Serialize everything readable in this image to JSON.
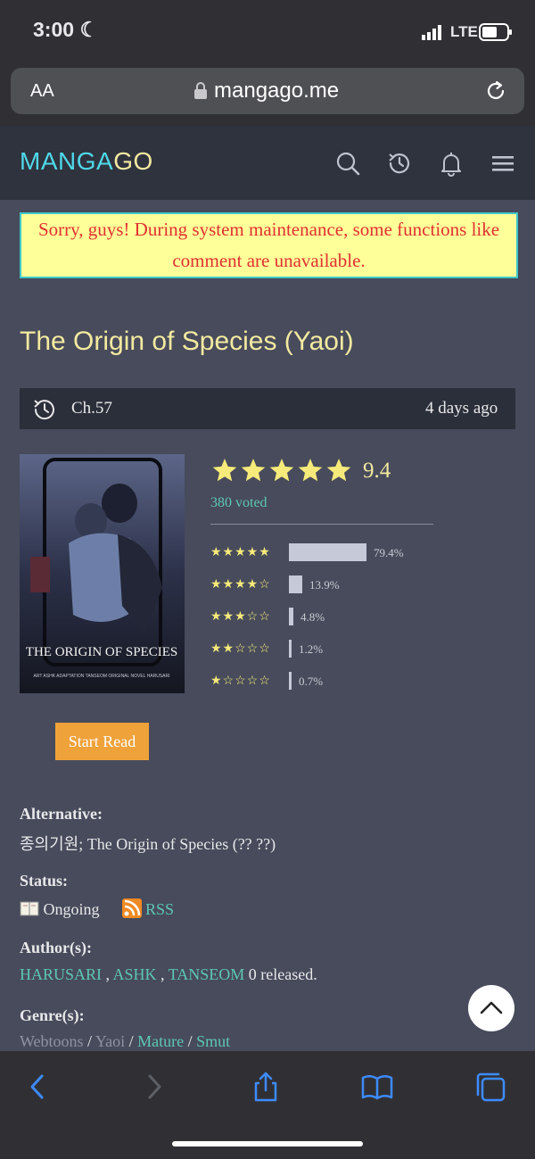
{
  "status_bar": {
    "time": "3:00",
    "network": "LTE"
  },
  "browser": {
    "text_size_label": "AA",
    "url": "mangago.me"
  },
  "site": {
    "logo_part1": "MANGA",
    "logo_part2": "GO",
    "icons": [
      "search-icon",
      "history-icon",
      "bell-icon",
      "menu-icon"
    ]
  },
  "notice": "Sorry, guys! During system maintenance, some functions like comment are unavailable.",
  "manga": {
    "title": "The Origin of Species (Yaoi)",
    "latest_chapter": "Ch.57",
    "updated": "4 days ago",
    "cover_title": "THE ORIGIN OF SPECIES",
    "cover_credits": "ART ASHK  ADAPTATION TANSEOM  ORIGINAL NOVEL HARUSARI",
    "rating": "9.4",
    "votes": "380 voted",
    "distribution": [
      {
        "stars": "★★★★★",
        "pct": "79.4%",
        "fraction": 0.794
      },
      {
        "stars": "★★★★☆",
        "pct": "13.9%",
        "fraction": 0.139
      },
      {
        "stars": "★★★☆☆",
        "pct": "4.8%",
        "fraction": 0.048
      },
      {
        "stars": "★★☆☆☆",
        "pct": "1.2%",
        "fraction": 0.012
      },
      {
        "stars": "★☆☆☆☆",
        "pct": "0.7%",
        "fraction": 0.007
      }
    ],
    "start_read_label": "Start Read",
    "alternative_label": "Alternative:",
    "alternative_value": "종의기원; The Origin of Species (?? ??)",
    "status_label": "Status:",
    "status_value": "Ongoing",
    "rss_label": "RSS",
    "authors_label": "Author(s):",
    "authors": [
      "HARUSARI",
      "ASHK",
      "TANSEOM"
    ],
    "released_text": "0 released.",
    "genre_label": "Genre(s):",
    "genres": [
      "Webtoons",
      "Yaoi",
      "Mature",
      "Smut"
    ]
  },
  "colors": {
    "logo_cyan": "#4fd8e8",
    "logo_yellow": "#f3e9a0",
    "accent_link": "#5ec7b2",
    "start_read_bg": "#f0a23a"
  }
}
